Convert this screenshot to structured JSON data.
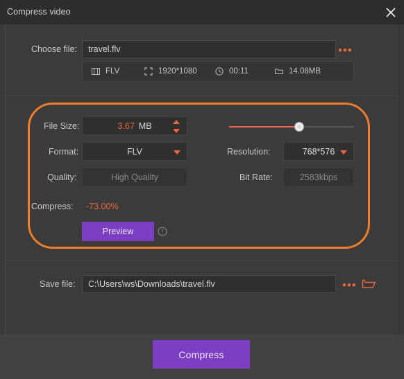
{
  "window": {
    "title": "Compress video",
    "close_icon": "close-icon"
  },
  "choose_file": {
    "label": "Choose file:",
    "value": "travel.flv",
    "browse_label": "•••",
    "meta": [
      {
        "icon": "film-strip-icon",
        "text": "FLV"
      },
      {
        "icon": "resize-corners-icon",
        "text": "1920*1080"
      },
      {
        "icon": "clock-icon",
        "text": "00:11"
      },
      {
        "icon": "folder-icon",
        "text": "14.08MB"
      }
    ]
  },
  "settings": {
    "file_size": {
      "label": "File Size:",
      "value": "3.67",
      "unit": "MB"
    },
    "format": {
      "label": "Format:",
      "value": "FLV"
    },
    "quality": {
      "label": "Quality:",
      "value": "High Quality"
    },
    "resolution": {
      "label": "Resolution:",
      "value": "768*576"
    },
    "bit_rate": {
      "label": "Bit Rate:",
      "value": "2583kbps"
    },
    "slider": {
      "percent": 56
    },
    "compress": {
      "label": "Compress:",
      "value": "-73.00%"
    },
    "preview_label": "Preview",
    "info_icon": "info-icon"
  },
  "save_file": {
    "label": "Save file:",
    "value": "C:\\Users\\ws\\Downloads\\travel.flv",
    "browse_label": "•••",
    "open_folder_icon": "open-folder-icon"
  },
  "footer": {
    "compress_button": "Compress"
  },
  "colors": {
    "accent_orange": "#f07d28",
    "accent_salmon": "#e8683c",
    "purple": "#7d3ec4",
    "window_bg": "#3a3a3a",
    "panel_bg": "#3b3b3b",
    "field_bg": "#303030"
  }
}
